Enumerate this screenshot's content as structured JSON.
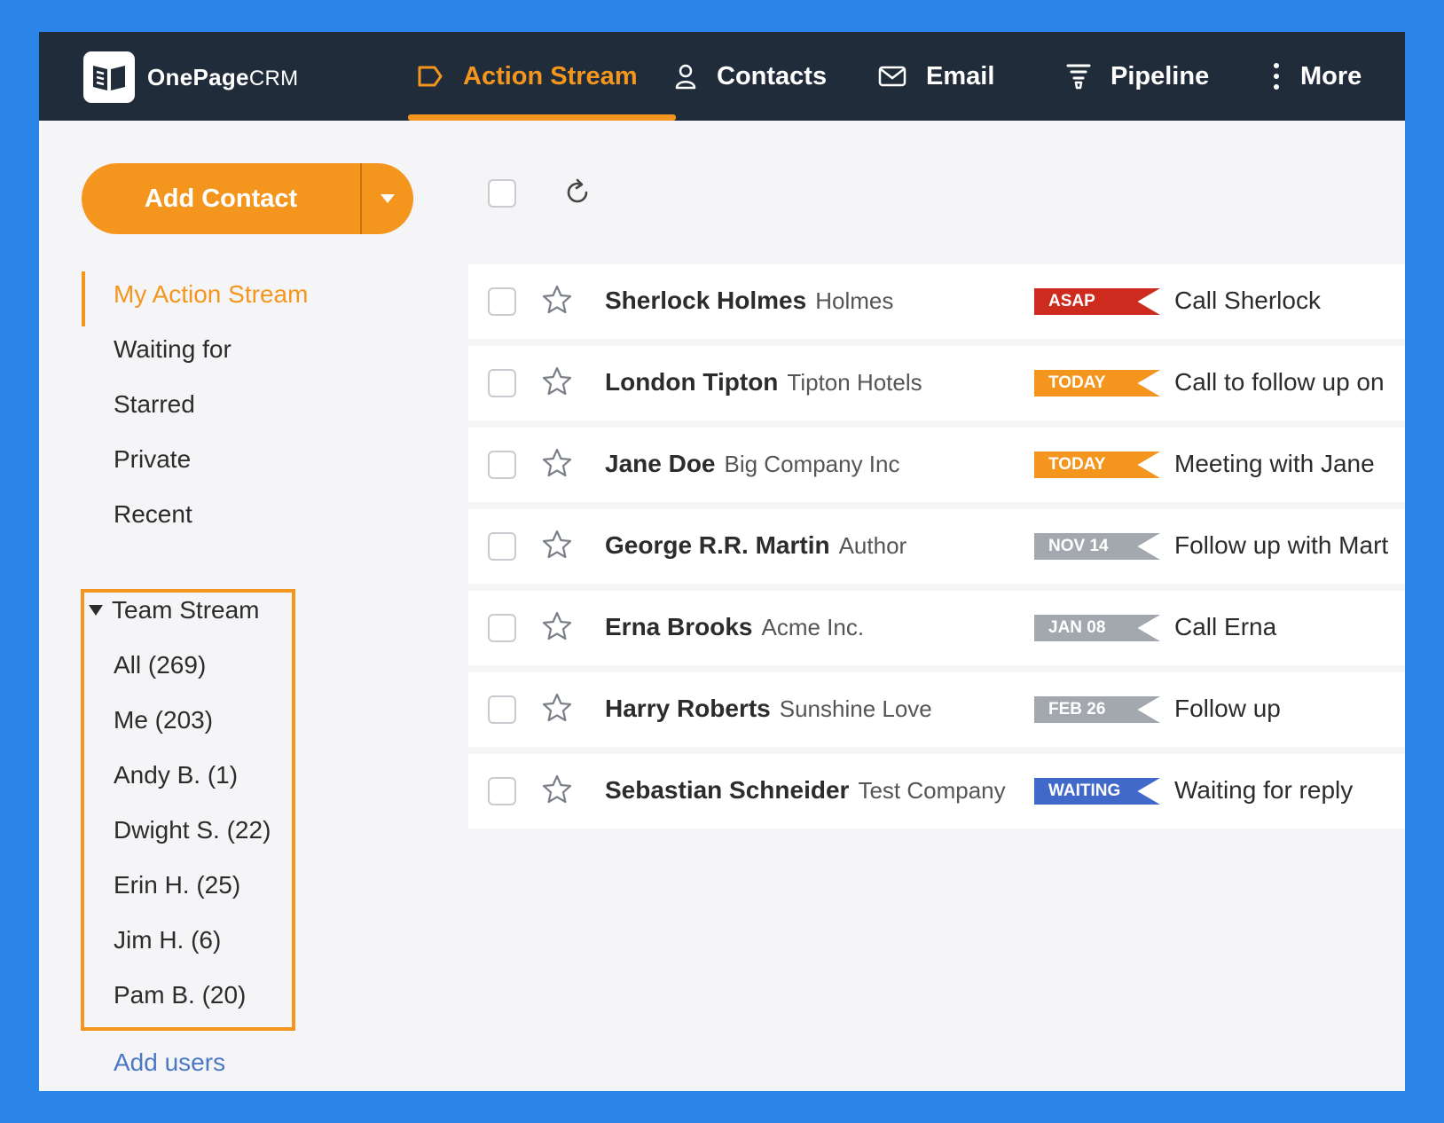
{
  "brand": {
    "name_bold": "OnePage",
    "name_light": "CRM"
  },
  "nav": [
    {
      "label": "Action Stream",
      "icon": "action-stream-icon",
      "active": true
    },
    {
      "label": "Contacts",
      "icon": "contacts-icon",
      "active": false
    },
    {
      "label": "Email",
      "icon": "email-icon",
      "active": false
    },
    {
      "label": "Pipeline",
      "icon": "pipeline-icon",
      "active": false
    },
    {
      "label": "More",
      "icon": "more-vertical-icon",
      "active": false
    }
  ],
  "sidebar": {
    "add_contact": "Add Contact",
    "links": [
      "My Action Stream",
      "Waiting for",
      "Starred",
      "Private",
      "Recent"
    ],
    "team_stream": {
      "title": "Team Stream",
      "members": [
        "All (269)",
        "Me (203)",
        "Andy B. (1)",
        "Dwight S. (22)",
        "Erin H. (25)",
        "Jim H. (6)",
        "Pam B. (20)"
      ]
    },
    "add_users": "Add users"
  },
  "colors": {
    "accent": "#f4961e",
    "asap": "#cc2b1d",
    "today": "#f4961e",
    "date": "#a3a7ae",
    "waiting": "#4169c9",
    "nav_bg": "#212c3a"
  },
  "rows": [
    {
      "name": "Sherlock Holmes",
      "company": "Holmes",
      "tag": "ASAP",
      "tag_color": "#cc2b1d",
      "action": "Call Sherlock"
    },
    {
      "name": "London Tipton",
      "company": "Tipton Hotels",
      "tag": "TODAY",
      "tag_color": "#f4961e",
      "action": "Call to follow up on"
    },
    {
      "name": "Jane Doe",
      "company": "Big Company Inc",
      "tag": "TODAY",
      "tag_color": "#f4961e",
      "action": "Meeting with Jane"
    },
    {
      "name": "George R.R. Martin",
      "company": "Author",
      "tag": "NOV 14",
      "tag_color": "#a3a7ae",
      "action": "Follow up with Mart"
    },
    {
      "name": "Erna Brooks",
      "company": "Acme Inc.",
      "tag": "JAN 08",
      "tag_color": "#a3a7ae",
      "action": "Call Erna"
    },
    {
      "name": "Harry Roberts",
      "company": "Sunshine Love",
      "tag": "FEB 26",
      "tag_color": "#a3a7ae",
      "action": "Follow up"
    },
    {
      "name": "Sebastian Schneider",
      "company": "Test Company",
      "tag": "WAITING",
      "tag_color": "#4169c9",
      "action": "Waiting for reply"
    }
  ]
}
